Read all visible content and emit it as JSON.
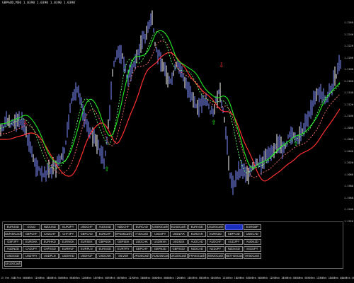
{
  "header": {
    "title": "GBPAUD,M30  1.0390 1.0390 1.0390 1.0390"
  },
  "price_axis": [
    "1.2260",
    "1.2240",
    "1.2220",
    "1.2200",
    "1.2180",
    "1.2160",
    "1.2140",
    "1.2120",
    "1.2100",
    "1.2080",
    "1.2060",
    "1.2040",
    "1.2020",
    "1.2000",
    "1.1980",
    "1.1960",
    "1.1940",
    "1.1920"
  ],
  "time_axis": [
    "15 Feb 2023",
    "15 Feb 06:00",
    "15 Feb 12:00",
    "15 Feb 18:00",
    "16 Feb 00:00",
    "16 Feb 06:00",
    "16 Feb 12:00",
    "16 Feb 18:00",
    "17 Feb 00:00",
    "17 Feb 06:00",
    "17 Feb 12:00",
    "17 Feb 18:00",
    "20 Feb 00:00",
    "20 Feb 06:00",
    "20 Feb 12:00",
    "20 Feb 18:00",
    "21 Feb 00:00",
    "21 Feb 06:00",
    "21 Feb 12:00",
    "21 Feb 18:00",
    "22 Feb 00:00",
    "22 Feb 06:00",
    "22 Feb 12:00",
    "22 Feb 18:00",
    "23 Feb 00:00",
    "23 Feb 06:00",
    "23 Feb 12:00",
    "23 Feb 18:00",
    "24 Feb 00:00",
    "24 Feb 06:00"
  ],
  "colors": {
    "background": "#000000",
    "bar": "#7f8cff",
    "bar_bright": "#ffffff",
    "ma_red": "#ff3030",
    "ma_red_dotted": "#ff7070",
    "ma_green": "#22ee22",
    "ma_green_dotted": "#66ff66",
    "arrow_red": "#ff3030",
    "arrow_green": "#22ee22",
    "active_symbol": "#1b2fbe"
  },
  "symbols": [
    [
      "EURUSD",
      "GOLD",
      "NZDUSD",
      "EURJPY",
      "USDCHF",
      "AUDUSD",
      "NZDCHF",
      "EURCAD",
      "US500Cash",
      "EUSDCash",
      "EURAUD",
      "US100Cash",
      "GBPAUD",
      "EURGBP"
    ],
    [
      "GER40Cash",
      "GBPCHF",
      "CADCHF",
      "CHFJPY",
      "GBPCAD",
      "EURCHF",
      "SPN35Cash",
      "IT40Cash",
      "USDJPY",
      "USDZAR",
      "EURZAR",
      "EURNZD",
      "GBPAUD",
      "USDCAD"
    ],
    [
      "GBPJPY",
      "EURDKK",
      "EURHKD",
      "EURNOK",
      "EURSEK",
      "GBPNOK",
      "GBPSEK",
      "USDCHK",
      "USDMXN",
      "USDSEK",
      "AUDCAD",
      "AUDCHF",
      "AUDJPY",
      "AUDNZD"
    ],
    [
      "AUDNZD",
      "CADJPY",
      "CHFSGD",
      "EURHUF",
      "EURPLN",
      "EURSGD",
      "EURTRY",
      "GBPCHF",
      "GBPNZD",
      "GBPSGD",
      "NZDCAD",
      "NZDJPY",
      "NZDSGD",
      "SGDJPY"
    ],
    [
      "USDSGD",
      "USDTRY",
      "USDPLN",
      "USDHKD",
      "USDHUF",
      "USDCNH",
      "SILVER",
      "JP225Cash",
      "AUS200Cash",
      "UK100Cash",
      "FRA40Cash",
      "SWI20Cash",
      "NETH25Cash",
      "HK50Cash"
    ],
    [
      "UK100Cash"
    ]
  ],
  "active_symbol": "GBPAUD",
  "arrows": [
    {
      "dir": "down",
      "color": "red",
      "label": "⇩"
    },
    {
      "dir": "down",
      "color": "red",
      "label": "⇩"
    },
    {
      "dir": "up",
      "color": "green",
      "label": "⇧"
    },
    {
      "dir": "up",
      "color": "green",
      "label": "⇧"
    },
    {
      "dir": "up",
      "color": "green",
      "label": "⇧"
    }
  ]
}
